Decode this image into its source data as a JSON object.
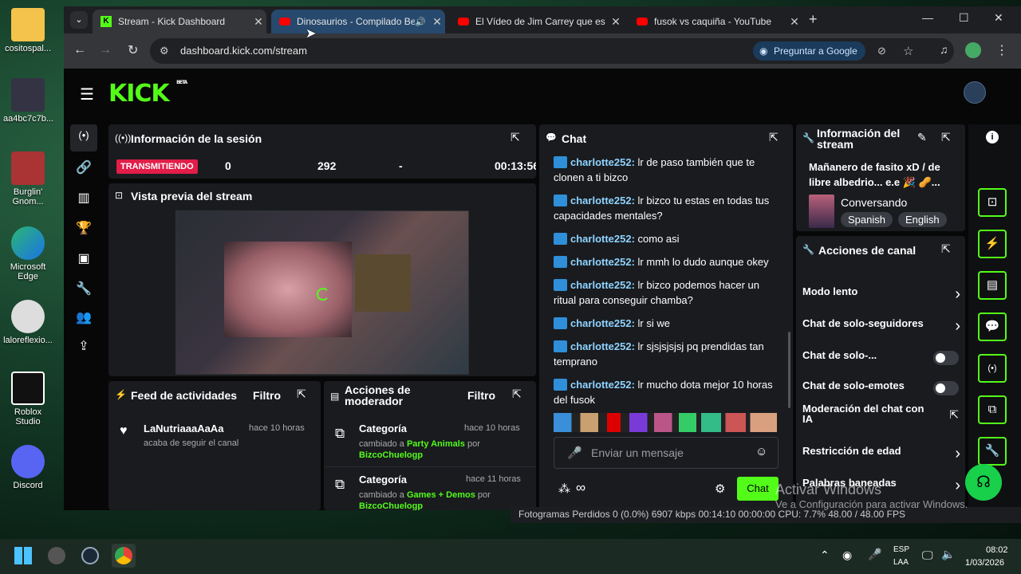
{
  "desktop": {
    "icons": [
      {
        "label": "cositospal..."
      },
      {
        "label": "aa4bc7c7b..."
      },
      {
        "label": "Burglin' Gnom..."
      },
      {
        "label": "Microsoft Edge"
      },
      {
        "label": "laloreflexio..."
      },
      {
        "label": "Roblox Studio"
      },
      {
        "label": "Discord"
      }
    ]
  },
  "tabs": [
    {
      "title": "Stream - Kick Dashboard",
      "active": true
    },
    {
      "title": "Dinosaurios - Compilado Be"
    },
    {
      "title": "El Vídeo de Jim Carrey que es e"
    },
    {
      "title": "fusok vs caquiña - YouTube"
    }
  ],
  "toolbar": {
    "url": "dashboard.kick.com/stream",
    "ask_google": "Preguntar a Google"
  },
  "kick": {
    "logo": "KICK",
    "beta": "BETA"
  },
  "session": {
    "title": "Información de la sesión",
    "status": "TRANSMITIENDO",
    "viewers": "0",
    "followers": "292",
    "subs": "-",
    "time": "00:13:56"
  },
  "preview": {
    "title": "Vista previa del stream"
  },
  "feed": {
    "title": "Feed de actividades",
    "filter": "Filtro",
    "items": [
      {
        "user": "LaNutriaaaAaAa",
        "time": "hace 10 horas",
        "text": "acaba de seguir el canal"
      }
    ]
  },
  "mod": {
    "title": "Acciones de moderador",
    "filter": "Filtro",
    "items": [
      {
        "kind": "Categoría",
        "time": "hace 10 horas",
        "pre": "cambiado a ",
        "val": "Party Animals",
        "mid": " por ",
        "user": "BizcoChuelogp"
      },
      {
        "kind": "Categoría",
        "time": "hace 11 horas",
        "pre": "cambiado a ",
        "val": "Games + Demos",
        "mid": " por ",
        "user": "BizcoChuelogp"
      }
    ]
  },
  "chat": {
    "title": "Chat",
    "placeholder": "Enviar un mensaje",
    "send": "Chat",
    "messages": [
      {
        "user": "charlotte252:",
        "text": " lr de paso también que te clonen a ti bizco"
      },
      {
        "user": "charlotte252:",
        "text": " lr bizco tu estas en todas tus capacidades mentales?"
      },
      {
        "user": "charlotte252:",
        "text": " como asi"
      },
      {
        "user": "charlotte252:",
        "text": " lr mmh lo dudo aunque okey"
      },
      {
        "user": "charlotte252:",
        "text": " lr bizco podemos hacer un ritual para conseguir chamba?"
      },
      {
        "user": "charlotte252:",
        "text": " lr si we"
      },
      {
        "user": "charlotte252:",
        "text": " lr sjsjsjsjsj pq prendidas tan temprano"
      },
      {
        "user": "charlotte252:",
        "text": " lr mucho dota mejor 10 horas del fusok"
      }
    ]
  },
  "streaminfo": {
    "title": "Información del stream",
    "stream_title": "Mañanero de fasito xD / de libre albedrio... e.e 🎉 🥜...",
    "category": "Conversando",
    "tags": [
      "Spanish",
      "English"
    ]
  },
  "channel": {
    "title": "Acciones de canal",
    "items": [
      {
        "label": "Modo lento",
        "type": "chevron"
      },
      {
        "label": "Chat de solo-seguidores",
        "type": "chevron"
      },
      {
        "label": "Chat de solo-...",
        "type": "toggle"
      },
      {
        "label": "Chat de solo-emotes",
        "type": "toggle"
      },
      {
        "label": "Moderación del chat con IA",
        "type": "link"
      },
      {
        "label": "Restricción de edad",
        "type": "chevron"
      },
      {
        "label": "Palabras baneadas",
        "type": "chevron"
      }
    ]
  },
  "obs": {
    "text": "Fotogramas Perdidos 0 (0.0%)   6907 kbps   00:14:10   00:00:00   CPU: 7.7%   48.00 / 48.00 FPS"
  },
  "watermark": {
    "line1": "Activar Windows",
    "line2": "Ve a Configuración para activar Windows."
  },
  "taskbar": {
    "lang1": "ESP",
    "lang2": "LAA",
    "time": "08:02",
    "date": "1/03/2026"
  },
  "colors": {
    "kick_green": "#53fc18",
    "live_red": "#e11d48",
    "chat_user": "#8fd4ff"
  }
}
